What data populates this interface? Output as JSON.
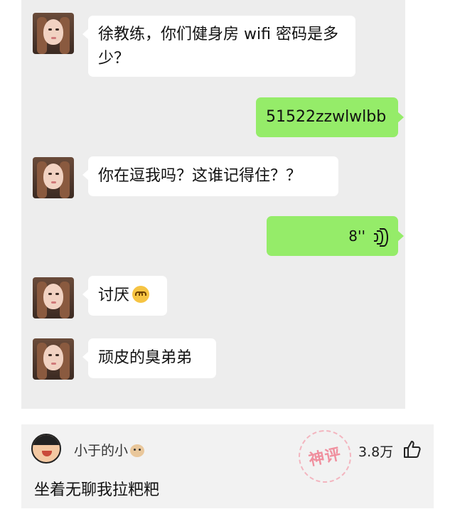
{
  "chat": {
    "messages": [
      {
        "side": "in",
        "text_line1": "徐教练，你们健身房 wifi 密码是多",
        "text_line2": "少？"
      },
      {
        "side": "out",
        "text": "51522zzwlwlbb"
      },
      {
        "side": "in",
        "text": "你在逗我吗？这谁记得住？？"
      },
      {
        "side": "out",
        "duration": "8''",
        "icon": "voice-icon"
      },
      {
        "side": "in",
        "text": "讨厌",
        "emoji": "blush-emoji"
      },
      {
        "side": "in",
        "text": "顽皮的臭弟弟"
      }
    ]
  },
  "comment": {
    "username": "小于的小",
    "username_emoji": "dog-emoji",
    "stamp": "神评",
    "likes": "3.8万",
    "like_icon": "thumbs-up-icon",
    "text": "坐着无聊我拉粑粑"
  },
  "colors": {
    "chat_bg": "#ededed",
    "incoming_bubble": "#ffffff",
    "outgoing_bubble": "#95ec69",
    "comment_bg": "#f2f2f2",
    "stamp": "#f08f9e"
  }
}
